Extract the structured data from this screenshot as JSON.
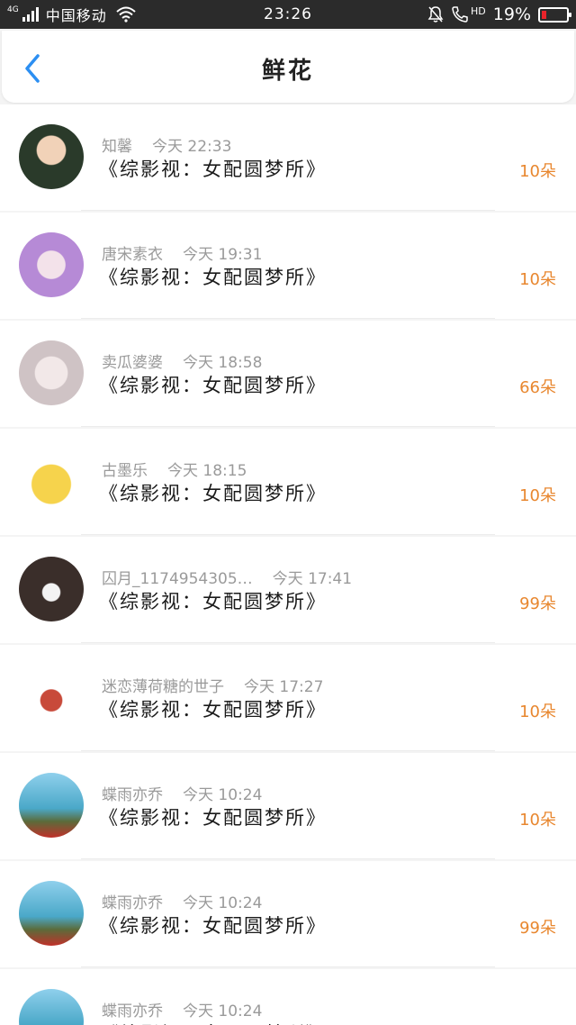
{
  "status_bar": {
    "network": "4G",
    "carrier": "中国移动",
    "time": "23:26",
    "hd": "HD",
    "battery_percent": "19%",
    "battery_level": 0.19,
    "battery_color": "#e8232a"
  },
  "nav": {
    "title": "鲜花",
    "back_icon": "chevron-left-icon",
    "accent_color": "#2c8ff2"
  },
  "flowers": [
    {
      "user": "知馨",
      "time": "今天 22:33",
      "book": "《综影视：女配圆梦所》",
      "count": "10朵"
    },
    {
      "user": "唐宋素衣",
      "time": "今天 19:31",
      "book": "《综影视：女配圆梦所》",
      "count": "10朵"
    },
    {
      "user": "卖瓜婆婆",
      "time": "今天 18:58",
      "book": "《综影视：女配圆梦所》",
      "count": "66朵"
    },
    {
      "user": "古墨乐",
      "time": "今天 18:15",
      "book": "《综影视：女配圆梦所》",
      "count": "10朵"
    },
    {
      "user": "囚月_1174954305…",
      "time": "今天 17:41",
      "book": "《综影视：女配圆梦所》",
      "count": "99朵"
    },
    {
      "user": "迷恋薄荷糖的世子",
      "time": "今天 17:27",
      "book": "《综影视：女配圆梦所》",
      "count": "10朵"
    },
    {
      "user": "蝶雨亦乔",
      "time": "今天 10:24",
      "book": "《综影视：女配圆梦所》",
      "count": "10朵"
    },
    {
      "user": "蝶雨亦乔",
      "time": "今天 10:24",
      "book": "《综影视：女配圆梦所》",
      "count": "99朵"
    },
    {
      "user": "蝶雨亦乔",
      "time": "今天 10:24",
      "book": "《综影视：女配圆梦所》",
      "count": ""
    }
  ],
  "colors": {
    "count_color": "#e8872f",
    "meta_color": "#9a9a9a"
  }
}
